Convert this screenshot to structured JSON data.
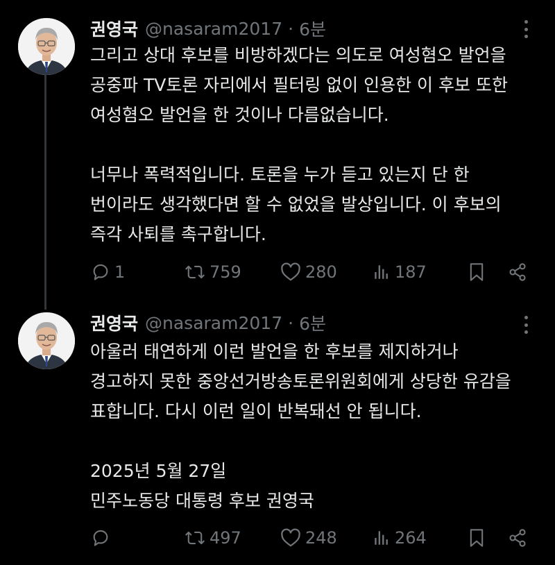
{
  "tweets": [
    {
      "author": {
        "name": "권영국",
        "handle": "@nasaram2017",
        "time": "6분"
      },
      "text": [
        "그리고 상대 후보를 비방하겠다는 의도로 여성혐오 발언을",
        "공중파 TV토론 자리에서 필터링 없이 인용한 이 후보 또한",
        "여성혐오 발언을 한 것이나 다름없습니다.",
        "",
        "너무나 폭력적입니다. 토론을 누가 듣고 있는지 단 한",
        "번이라도 생각했다면 할 수 없었을 발상입니다. 이 후보의",
        "즉각 사퇴를 촉구합니다."
      ],
      "stats": {
        "replies": "1",
        "reposts": "759",
        "likes": "280",
        "views": "187"
      },
      "icons": [
        "reply-icon",
        "repost-icon",
        "like-icon",
        "views-icon",
        "bookmark-icon",
        "share-icon"
      ]
    },
    {
      "author": {
        "name": "권영국",
        "handle": "@nasaram2017",
        "time": "6분"
      },
      "text": [
        "아울러 태연하게 이런 발언을 한 후보를 제지하거나",
        "경고하지 못한 중앙선거방송토론위원회에게 상당한 유감을",
        "표합니다. 다시 이런 일이 반복돼선 안 됩니다.",
        "",
        "2025년 5월 27일",
        "민주노동당 대통령 후보 권영국"
      ],
      "stats": {
        "replies": "",
        "reposts": "497",
        "likes": "248",
        "views": "264"
      },
      "icons": [
        "reply-icon",
        "repost-icon",
        "like-icon",
        "views-icon",
        "bookmark-icon",
        "share-icon"
      ]
    }
  ],
  "colors": {
    "background": "#000000",
    "text": "#e7e9ea",
    "muted": "#71767b",
    "thread_line": "#333639"
  }
}
